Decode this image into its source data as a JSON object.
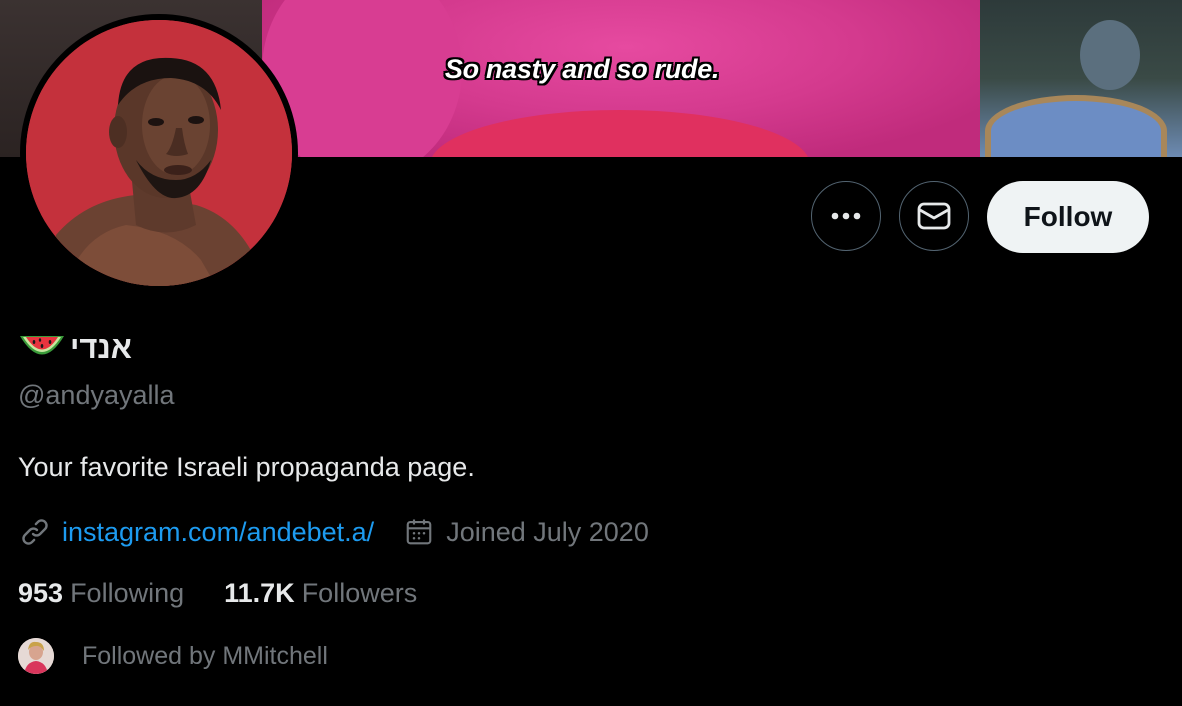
{
  "banner": {
    "caption": "So nasty and so rude."
  },
  "profile": {
    "display_name": "אנדי",
    "name_emoji": "watermelon-icon",
    "handle": "@andyayalla",
    "bio": "Your favorite Israeli propaganda page.",
    "link_text": "instagram.com/andebet.a/",
    "joined": "Joined July 2020",
    "following_count": "953",
    "following_label": "Following",
    "followers_count": "11.7K",
    "followers_label": "Followers",
    "followed_by": "Followed by MMitchell"
  },
  "actions": {
    "more_icon": "more-icon",
    "message_icon": "envelope-icon",
    "follow_label": "Follow"
  },
  "colors": {
    "background": "#000000",
    "text_primary": "#e7e9ea",
    "text_secondary": "#71767b",
    "link": "#1d9bf0",
    "follow_button_bg": "#eff3f4",
    "avatar_bg": "#c4313c"
  }
}
